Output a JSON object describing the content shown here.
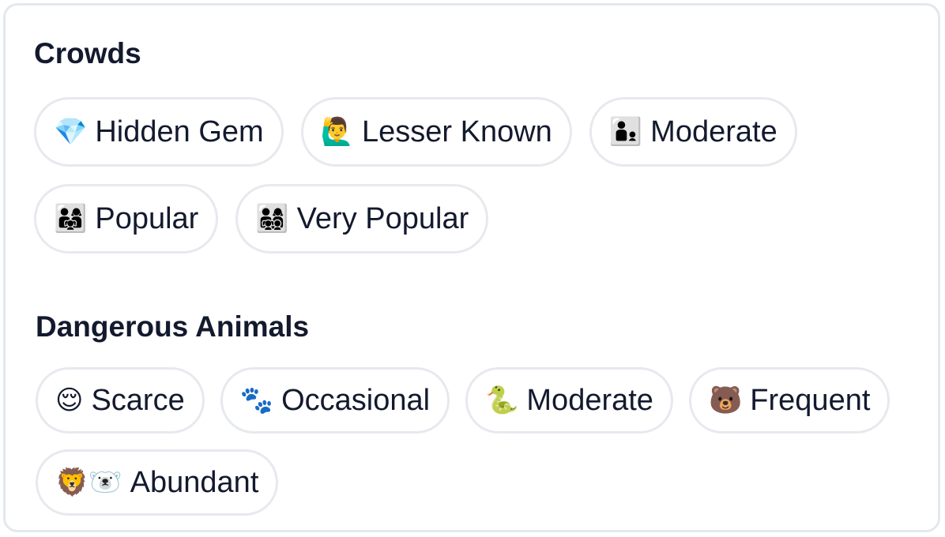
{
  "sections": [
    {
      "title": "Crowds",
      "chips": [
        {
          "icon": "gem-icon",
          "emoji": "💎",
          "label": "Hidden Gem"
        },
        {
          "icon": "raising-hand-icon",
          "emoji": "🙋‍♂️",
          "label": "Lesser Known"
        },
        {
          "icon": "man-with-child-icon",
          "emoji": "👨‍👦",
          "label": "Moderate"
        },
        {
          "icon": "family-icon",
          "emoji": "👨‍👩‍👧",
          "label": "Popular"
        },
        {
          "icon": "large-family-icon",
          "emoji": "👨‍👩‍👧‍👦",
          "label": "Very Popular"
        }
      ]
    },
    {
      "title": "Dangerous Animals",
      "chips": [
        {
          "icon": "relieved-face-icon",
          "emoji": "😌",
          "label": "Scarce"
        },
        {
          "icon": "paw-prints-icon",
          "emoji": "🐾",
          "label": "Occasional"
        },
        {
          "icon": "snake-icon",
          "emoji": "🐍",
          "label": "Moderate"
        },
        {
          "icon": "bear-icon",
          "emoji": "🐻",
          "label": "Frequent"
        },
        {
          "icon": "lion-polar-bear-icon",
          "emoji": "🦁🐻‍❄️",
          "label": "Abundant"
        }
      ]
    }
  ]
}
